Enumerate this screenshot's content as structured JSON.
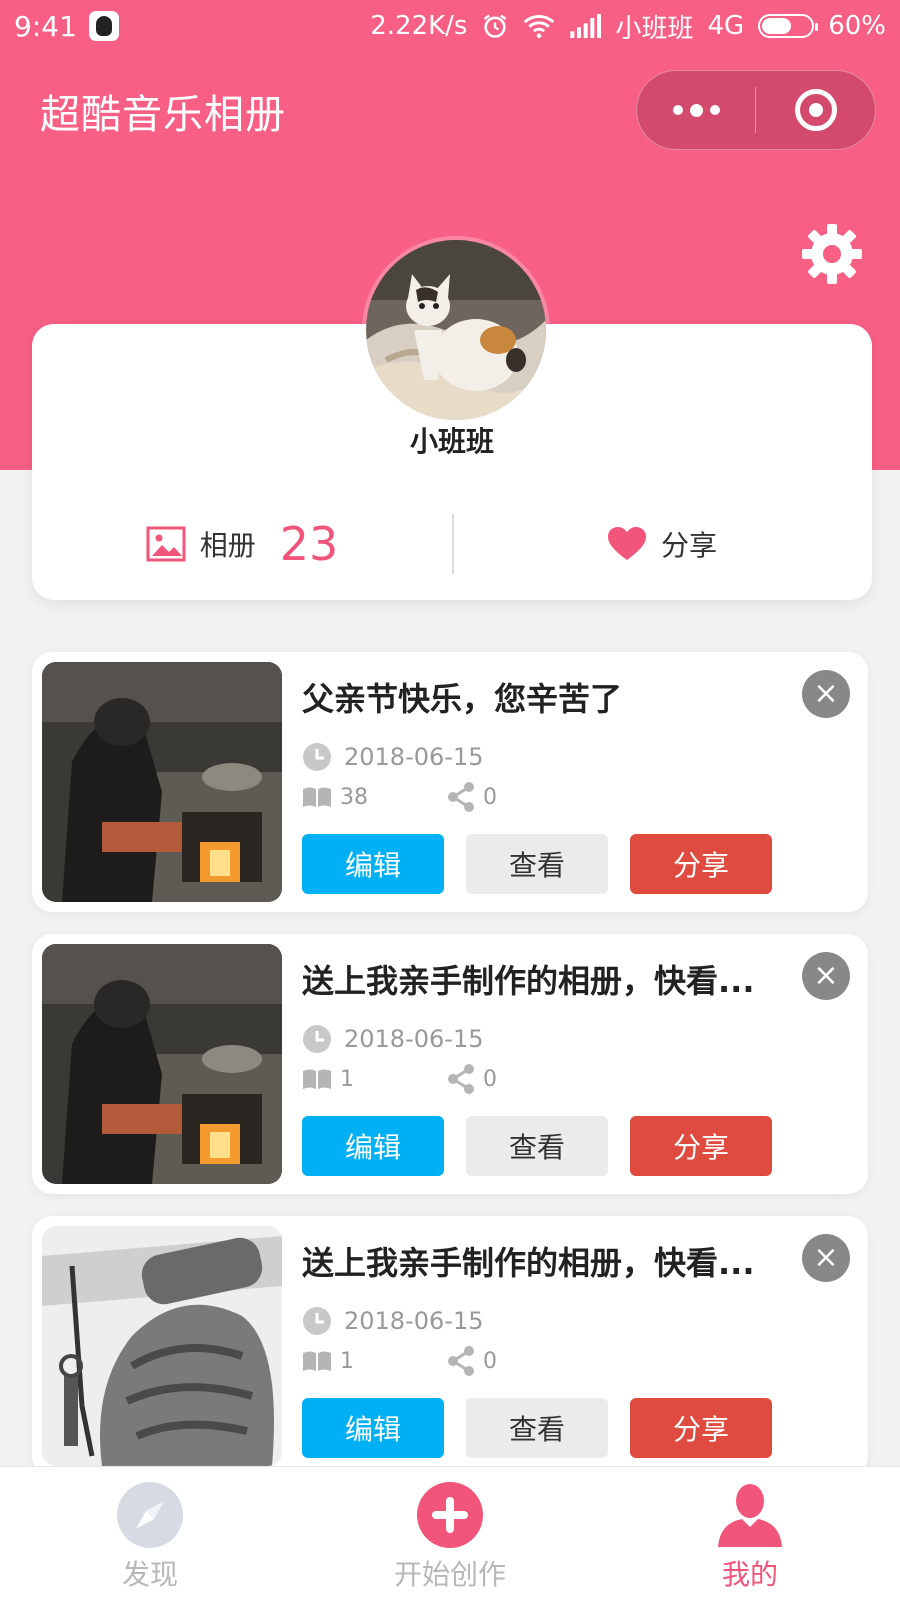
{
  "status_bar": {
    "time": "9:41",
    "speed": "2.22K/s",
    "carrier": "小班班",
    "network": "4G",
    "battery": "60%",
    "battery_level": 0.6
  },
  "header": {
    "title": "超酷音乐相册"
  },
  "profile": {
    "username": "小班班",
    "album_label": "相册",
    "album_count": "23",
    "share_label": "分享"
  },
  "albums": [
    {
      "title": "父亲节快乐，您辛苦了",
      "date": "2018-06-15",
      "views": "38",
      "shares": "0",
      "edit_label": "编辑",
      "view_label": "查看",
      "share_label": "分享"
    },
    {
      "title": "送上我亲手制作的相册，快看...",
      "date": "2018-06-15",
      "views": "1",
      "shares": "0",
      "edit_label": "编辑",
      "view_label": "查看",
      "share_label": "分享"
    },
    {
      "title": "送上我亲手制作的相册，快看...",
      "date": "2018-06-15",
      "views": "1",
      "shares": "0",
      "edit_label": "编辑",
      "view_label": "查看",
      "share_label": "分享"
    }
  ],
  "tabbar": {
    "items": [
      {
        "label": "发现",
        "icon": "compass-icon"
      },
      {
        "label": "开始创作",
        "icon": "plus-circle-icon"
      },
      {
        "label": "我的",
        "icon": "user-icon"
      }
    ]
  },
  "colors": {
    "brand": "#f75f84",
    "accent_pink": "#f2557a",
    "edit_blue": "#00b0f5",
    "share_red": "#e04b40"
  }
}
